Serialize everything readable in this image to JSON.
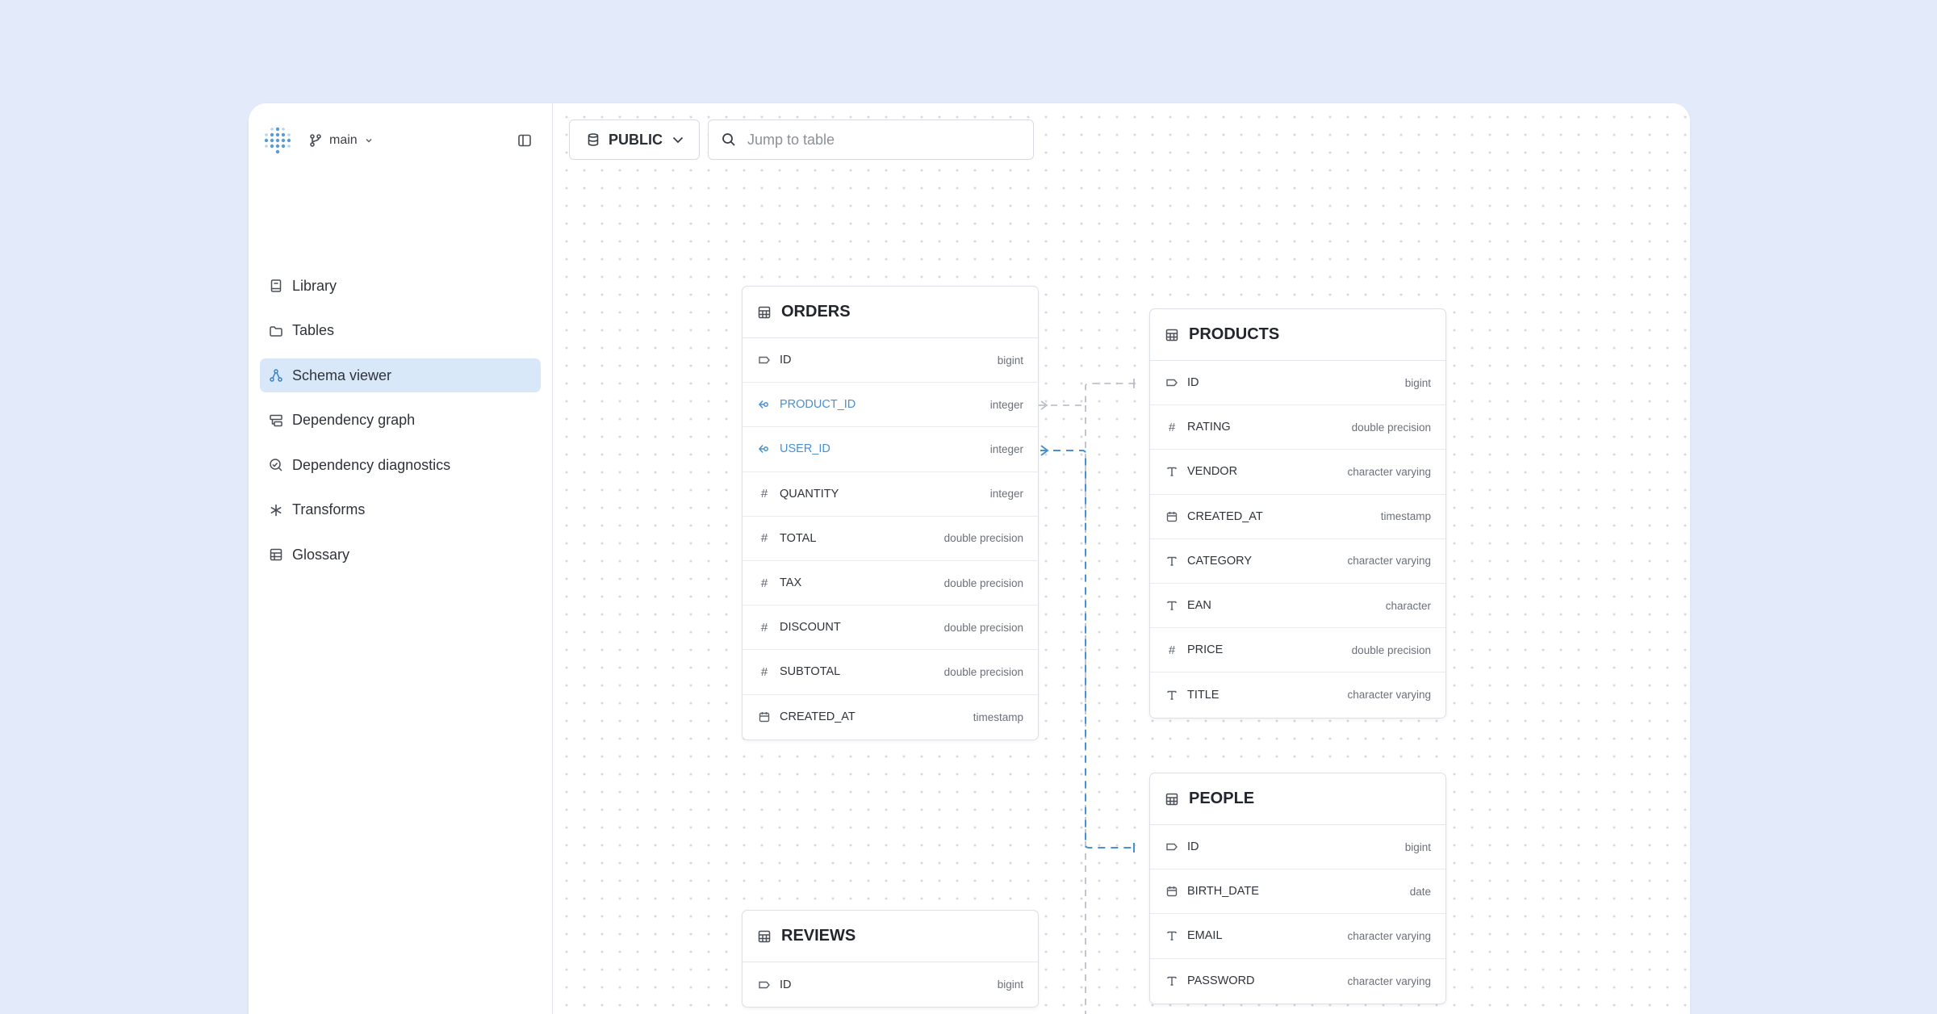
{
  "branch": {
    "name": "main"
  },
  "sidebar": {
    "items": [
      {
        "label": "Library",
        "icon": "book-icon",
        "active": false
      },
      {
        "label": "Tables",
        "icon": "folder-icon",
        "active": false
      },
      {
        "label": "Schema viewer",
        "icon": "schema-icon",
        "active": true
      },
      {
        "label": "Dependency graph",
        "icon": "dependency-graph-icon",
        "active": false
      },
      {
        "label": "Dependency diagnostics",
        "icon": "diagnostics-icon",
        "active": false
      },
      {
        "label": "Transforms",
        "icon": "asterisk-icon",
        "active": false
      },
      {
        "label": "Glossary",
        "icon": "table-grid-icon",
        "active": false
      }
    ]
  },
  "toolbar": {
    "schema_label": "PUBLIC",
    "search_placeholder": "Jump to table",
    "search_value": ""
  },
  "colors": {
    "accent": "#4a90d0",
    "active_bg": "#d9e8f9",
    "background": "#e3eafa"
  },
  "tables": {
    "orders": {
      "name": "ORDERS",
      "columns": [
        {
          "name": "ID",
          "type": "bigint",
          "icon": "key-tag-icon",
          "fk": false
        },
        {
          "name": "PRODUCT_ID",
          "type": "integer",
          "icon": "foreign-key-icon",
          "fk": true
        },
        {
          "name": "USER_ID",
          "type": "integer",
          "icon": "foreign-key-icon",
          "fk": true
        },
        {
          "name": "QUANTITY",
          "type": "integer",
          "icon": "hash-icon",
          "fk": false
        },
        {
          "name": "TOTAL",
          "type": "double precision",
          "icon": "hash-icon",
          "fk": false
        },
        {
          "name": "TAX",
          "type": "double precision",
          "icon": "hash-icon",
          "fk": false
        },
        {
          "name": "DISCOUNT",
          "type": "double precision",
          "icon": "hash-icon",
          "fk": false
        },
        {
          "name": "SUBTOTAL",
          "type": "double precision",
          "icon": "hash-icon",
          "fk": false
        },
        {
          "name": "CREATED_AT",
          "type": "timestamp",
          "icon": "calendar-icon",
          "fk": false
        }
      ]
    },
    "products": {
      "name": "PRODUCTS",
      "columns": [
        {
          "name": "ID",
          "type": "bigint",
          "icon": "key-tag-icon",
          "fk": false
        },
        {
          "name": "RATING",
          "type": "double precision",
          "icon": "hash-icon",
          "fk": false
        },
        {
          "name": "VENDOR",
          "type": "character varying",
          "icon": "text-icon",
          "fk": false
        },
        {
          "name": "CREATED_AT",
          "type": "timestamp",
          "icon": "calendar-icon",
          "fk": false
        },
        {
          "name": "CATEGORY",
          "type": "character varying",
          "icon": "text-icon",
          "fk": false
        },
        {
          "name": "EAN",
          "type": "character",
          "icon": "text-icon",
          "fk": false
        },
        {
          "name": "PRICE",
          "type": "double precision",
          "icon": "hash-icon",
          "fk": false
        },
        {
          "name": "TITLE",
          "type": "character varying",
          "icon": "text-icon",
          "fk": false
        }
      ]
    },
    "people": {
      "name": "PEOPLE",
      "columns": [
        {
          "name": "ID",
          "type": "bigint",
          "icon": "key-tag-icon",
          "fk": false
        },
        {
          "name": "BIRTH_DATE",
          "type": "date",
          "icon": "calendar-icon",
          "fk": false
        },
        {
          "name": "EMAIL",
          "type": "character varying",
          "icon": "text-icon",
          "fk": false
        },
        {
          "name": "PASSWORD",
          "type": "character varying",
          "icon": "text-icon",
          "fk": false
        }
      ]
    },
    "reviews": {
      "name": "REVIEWS",
      "columns": [
        {
          "name": "ID",
          "type": "bigint",
          "icon": "key-tag-icon",
          "fk": false
        }
      ]
    }
  }
}
